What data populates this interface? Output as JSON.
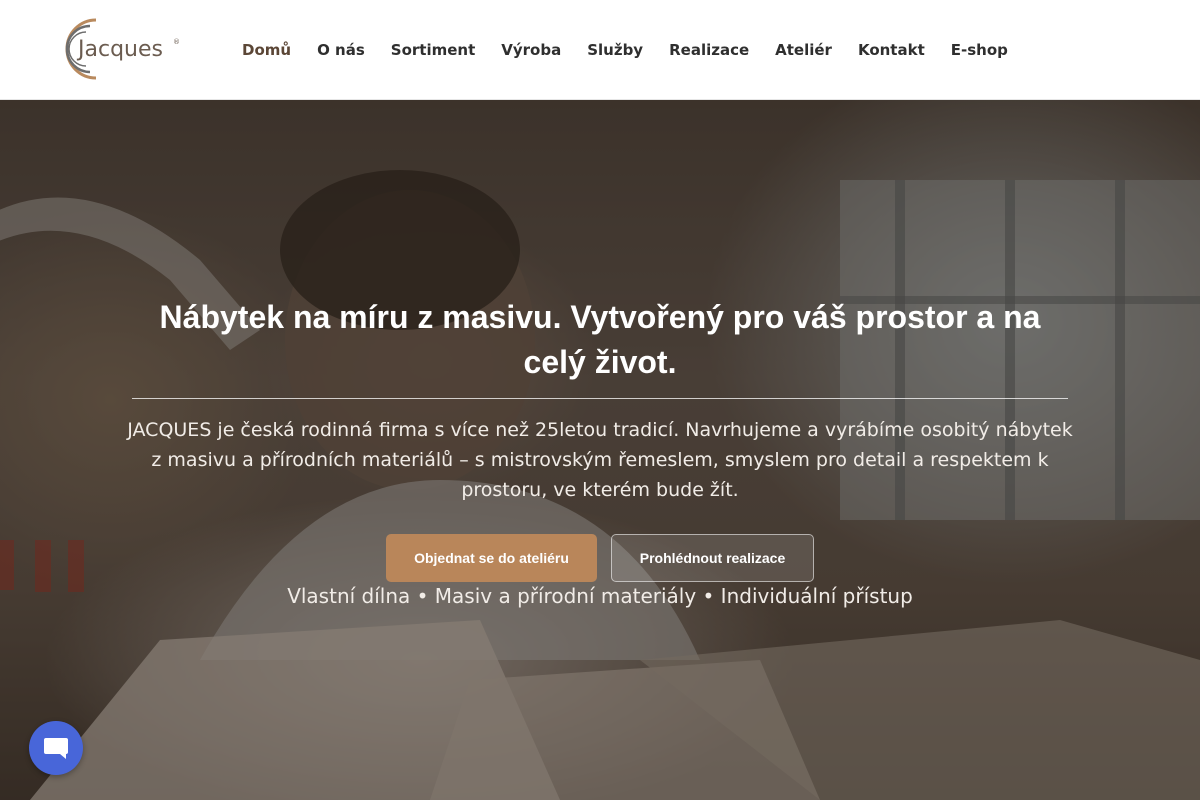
{
  "brand": {
    "logo_text": "Jacques",
    "logo_colors": {
      "outer_arc": "#b98a5e",
      "inner_arc": "#6d6d6d",
      "text": "#6b5c50"
    }
  },
  "nav": {
    "items": [
      {
        "label": "Domů",
        "active": true
      },
      {
        "label": "O nás",
        "active": false
      },
      {
        "label": "Sortiment",
        "active": false
      },
      {
        "label": "Výroba",
        "active": false
      },
      {
        "label": "Služby",
        "active": false
      },
      {
        "label": "Realizace",
        "active": false
      },
      {
        "label": "Ateliér",
        "active": false
      },
      {
        "label": "Kontakt",
        "active": false
      },
      {
        "label": "E-shop",
        "active": false
      }
    ]
  },
  "hero": {
    "title": "Nábytek na míru z masivu. Vytvořený pro váš prostor a na celý život.",
    "description": "JACQUES je česká rodinná firma s více než 25letou tradicí. Navrhujeme a vyrábíme osobitý nábytek z masivu a přírodních materiálů – s mistrovským řemeslem, smyslem pro detail a respektem k prostoru, ve kterém bude žít.",
    "primary_button": "Objednat se do ateliéru",
    "secondary_button": "Prohlédnout realizace",
    "features": "Vlastní dílna • Masiv a přírodní materiály • Individuální přístup",
    "background_image": "carpenter-in-workshop-photo"
  },
  "chat_widget": {
    "icon": "chat-bubble-icon",
    "color": "#4866d9"
  },
  "colors": {
    "accent": "#b9865a",
    "nav_active": "#5b4636",
    "nav_text": "#2f2f2f"
  }
}
